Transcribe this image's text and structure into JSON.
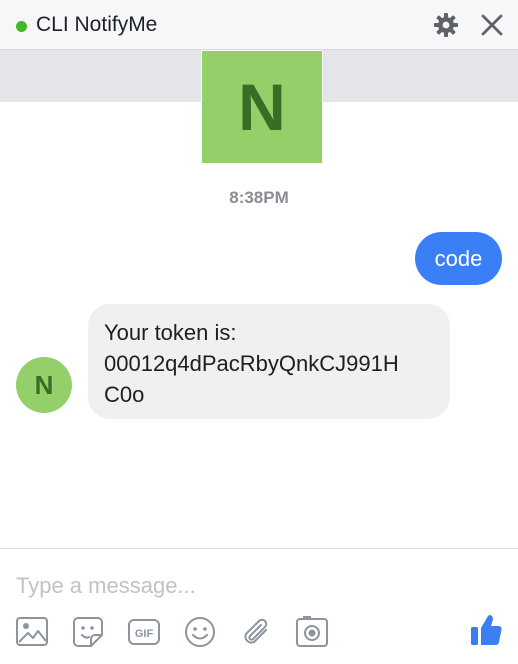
{
  "window": {
    "title": "CLI NotifyMe",
    "status_color": "#42b72a",
    "icons": [
      "gear-icon",
      "close-icon"
    ]
  },
  "contact": {
    "initial": "N",
    "avatar_color": "#94d069",
    "initial_color": "#356e24"
  },
  "conversation": {
    "timestamp": "8:38PM",
    "messages": [
      {
        "sender": "me",
        "text": "code",
        "bubble_color": "#3b7ff7"
      },
      {
        "sender": "contact",
        "lines": [
          "Your token is:",
          "00012q4dPacRbyQnkCJ991H",
          "C0o"
        ],
        "bubble_color": "#f1f0f0"
      }
    ]
  },
  "composer": {
    "placeholder": "Type a message...",
    "value": "",
    "toolbar_icons": [
      "image-icon",
      "sticker-icon",
      "gif-icon",
      "emoji-icon",
      "attachment-icon",
      "camera-icon"
    ],
    "gif_label": "GIF",
    "like_icon": "thumbs-up-icon",
    "like_color": "#3b7ff7"
  }
}
